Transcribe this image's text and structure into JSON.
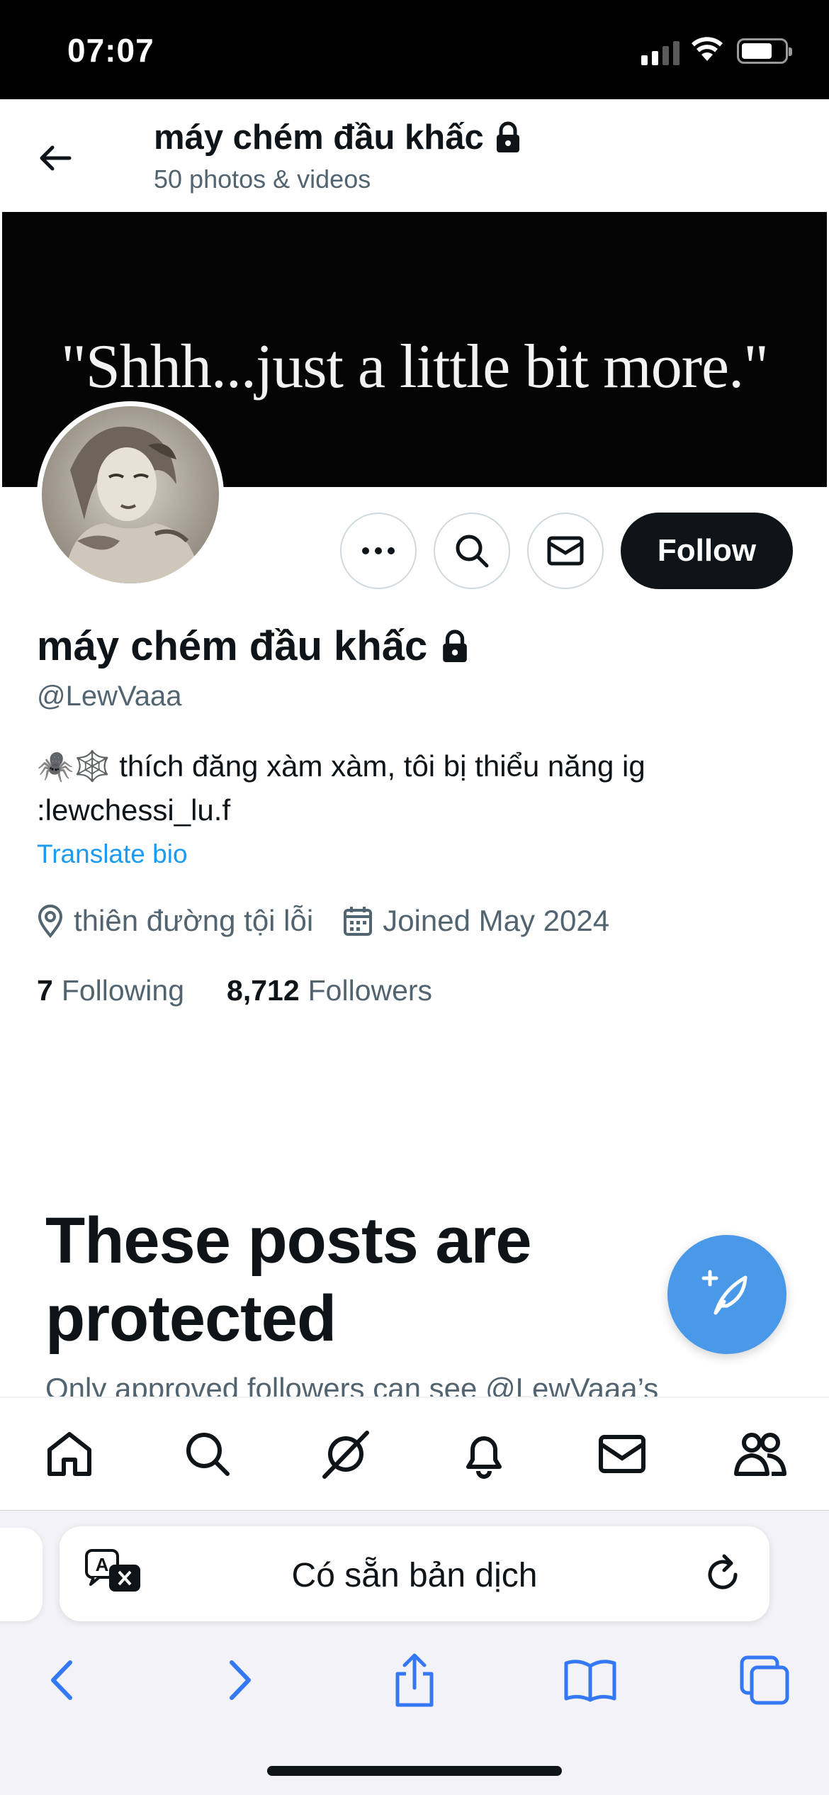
{
  "status_bar": {
    "time": "07:07"
  },
  "header": {
    "name": "máy chém đầu khấc",
    "subtitle": "50 photos & videos"
  },
  "banner": {
    "quote": "\"Shhh...just a little bit more.\""
  },
  "actions": {
    "follow_label": "Follow"
  },
  "profile": {
    "name": "máy chém đầu khấc",
    "handle": "@LewVaaa",
    "bio_line1": "🕷️🕸️ thích đăng xàm xàm, tôi bị thiểu năng ig",
    "bio_line2": ":lewchessi_lu.f",
    "translate_label": "Translate bio",
    "location": "thiên đường tội lỗi",
    "joined": "Joined May 2024",
    "following_count": "7",
    "following_label": "Following",
    "followers_count": "8,712",
    "followers_label": "Followers"
  },
  "protected": {
    "title_line1": "These posts are",
    "title_line2": "protected",
    "description": "Only approved followers can see @LewVaaa’s"
  },
  "tabbar": {
    "items": [
      "home-icon",
      "search-icon",
      "grok-icon",
      "notifications-icon",
      "messages-icon",
      "communities-icon"
    ]
  },
  "safari": {
    "translation_text": "Có sẵn bản dịch"
  },
  "colors": {
    "accent": "#1d9bf0",
    "fab": "#4a99e9",
    "text_primary": "#0f1419",
    "text_secondary": "#536471",
    "ios_blue": "#3478f6"
  }
}
